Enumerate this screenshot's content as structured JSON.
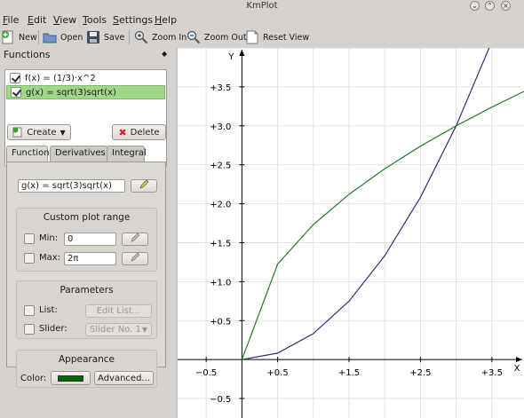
{
  "window": {
    "title": "KmPlot"
  },
  "menu": [
    "File",
    "Edit",
    "View",
    "Tools",
    "Settings",
    "Help"
  ],
  "toolbar": {
    "new": "New",
    "open": "Open",
    "save": "Save",
    "zoom_in": "Zoom In",
    "zoom_out": "Zoom Out",
    "reset_view": "Reset View"
  },
  "functions_panel": {
    "title": "Functions",
    "items": [
      {
        "label": "f(x) = (1/3)·x^2",
        "checked": true,
        "selected": false
      },
      {
        "label": "g(x) = sqrt(3)sqrt(x)",
        "checked": true,
        "selected": true
      }
    ],
    "create_label": "Create",
    "delete_label": "Delete"
  },
  "tabs": [
    "Function",
    "Derivatives",
    "Integral"
  ],
  "function_tab": {
    "expression": "g(x) = sqrt(3)sqrt(x)",
    "custom_range": {
      "title": "Custom plot range",
      "min_label": "Min:",
      "min_value": "0",
      "max_label": "Max:",
      "max_value": "2π"
    },
    "parameters": {
      "title": "Parameters",
      "list_label": "List:",
      "edit_list": "Edit List...",
      "slider_label": "Slider:",
      "slider_value": "Slider No. 1"
    },
    "appearance": {
      "title": "Appearance",
      "color_label": "Color:",
      "color": "#006600",
      "advanced": "Advanced..."
    }
  },
  "chart_data": {
    "type": "line",
    "xlabel": "X",
    "ylabel": "Y",
    "xlim": [
      -0.9,
      3.95
    ],
    "ylim": [
      -0.75,
      4.0
    ],
    "x_ticks": [
      -0.5,
      0.5,
      1.5,
      2.5,
      3.5
    ],
    "x_tick_labels": [
      "−0.5",
      "+0.5",
      "+1.5",
      "+2.5",
      "+3.5"
    ],
    "y_ticks": [
      -0.5,
      0.5,
      1.0,
      1.5,
      2.0,
      2.5,
      3.0,
      3.5
    ],
    "y_tick_labels": [
      "−0.5",
      "+0.5",
      "+1.0",
      "+1.5",
      "+2.0",
      "+2.5",
      "+3.0",
      "+3.5"
    ],
    "grid": true,
    "series": [
      {
        "name": "f(x) = (1/3)·x^2",
        "color": "#2e2e7a",
        "x": [
          0,
          0.5,
          1,
          1.5,
          2,
          2.5,
          3,
          3.5
        ],
        "y": [
          0,
          0.083,
          0.333,
          0.75,
          1.333,
          2.083,
          3,
          4.083
        ]
      },
      {
        "name": "g(x) = sqrt(3)sqrt(x)",
        "color": "#2b7a2b",
        "x": [
          0,
          0.5,
          1,
          1.5,
          2,
          2.5,
          3,
          3.5,
          3.95
        ],
        "y": [
          0,
          1.225,
          1.732,
          2.121,
          2.449,
          2.739,
          3,
          3.24,
          3.442
        ]
      }
    ]
  }
}
